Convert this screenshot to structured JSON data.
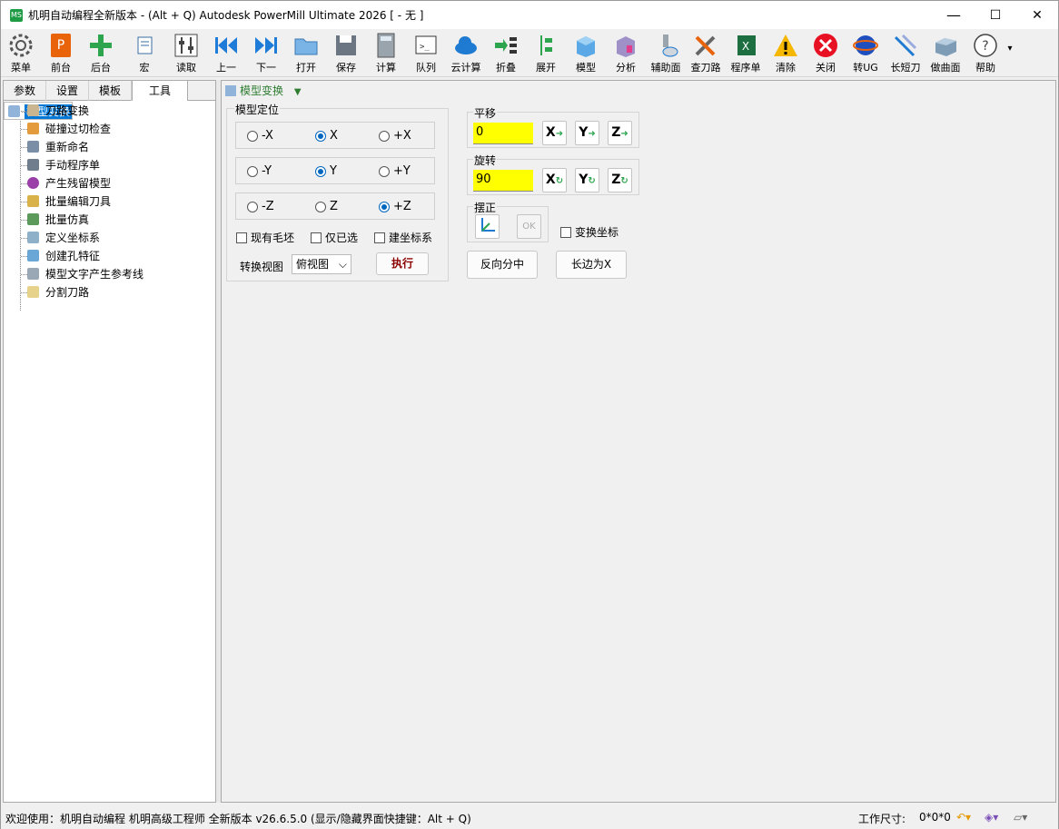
{
  "window": {
    "title": "机明自动编程全新版本 - (Alt + Q) Autodesk PowerMill Ultimate 2026    [  - 无 ]",
    "app_icon": "MS",
    "minimize": "—",
    "maximize": "☐",
    "close": "✕"
  },
  "toolbar": [
    "菜单",
    "前台",
    "后台",
    "宏",
    "读取",
    "上一",
    "下一",
    "打开",
    "保存",
    "计算",
    "队列",
    "云计算",
    "折叠",
    "展开",
    "模型",
    "分析",
    "辅助面",
    "查刀路",
    "程序单",
    "清除",
    "关闭",
    "转UG",
    "长短刀",
    "做曲面",
    "帮助"
  ],
  "toolbar_more": "▾",
  "left_tabs": [
    "参数",
    "设置",
    "模板",
    "工具"
  ],
  "tree": [
    "模型变换",
    "刀路变换",
    "碰撞过切检查",
    "重新命名",
    "手动程序单",
    "产生残留模型",
    "批量编辑刀具",
    "批量仿真",
    "定义坐标系",
    "创建孔特征",
    "模型文字产生参考线",
    "分割刀路"
  ],
  "panel": {
    "title": "模型变换",
    "title_arrow": "▼",
    "group_position": "模型定位",
    "row1": [
      "-X",
      "X",
      "+X"
    ],
    "row2": [
      "-Y",
      "Y",
      "+Y"
    ],
    "row3": [
      "-Z",
      "Z",
      "+Z"
    ],
    "chk_blank": "现有毛坯",
    "chk_selected": "仅已选",
    "chk_coord": "建坐标系",
    "view_label": "转换视图",
    "view_value": "俯视图",
    "view_arrow": "⌵",
    "exec": "执行",
    "translate_title": "平移",
    "translate_value": "0",
    "rotate_title": "旋转",
    "rotate_value": "90",
    "axis_x": "X",
    "axis_y": "Y",
    "axis_z": "Z",
    "align_title": "摆正",
    "ok": "OK",
    "chk_transform": "变换坐标",
    "reverse": "反向分中",
    "long_x": "长边为X"
  },
  "status": {
    "welcome": "欢迎使用：机明自动编程 机明高级工程师 全新版本 v26.6.5.0  (显示/隐藏界面快捷键：Alt + Q)",
    "size_label": "工作尺寸:",
    "size_value": "0*0*0"
  },
  "colors": {
    "accent": "#0078d7",
    "yellow": "#ffff00",
    "green": "#2e7d32"
  }
}
